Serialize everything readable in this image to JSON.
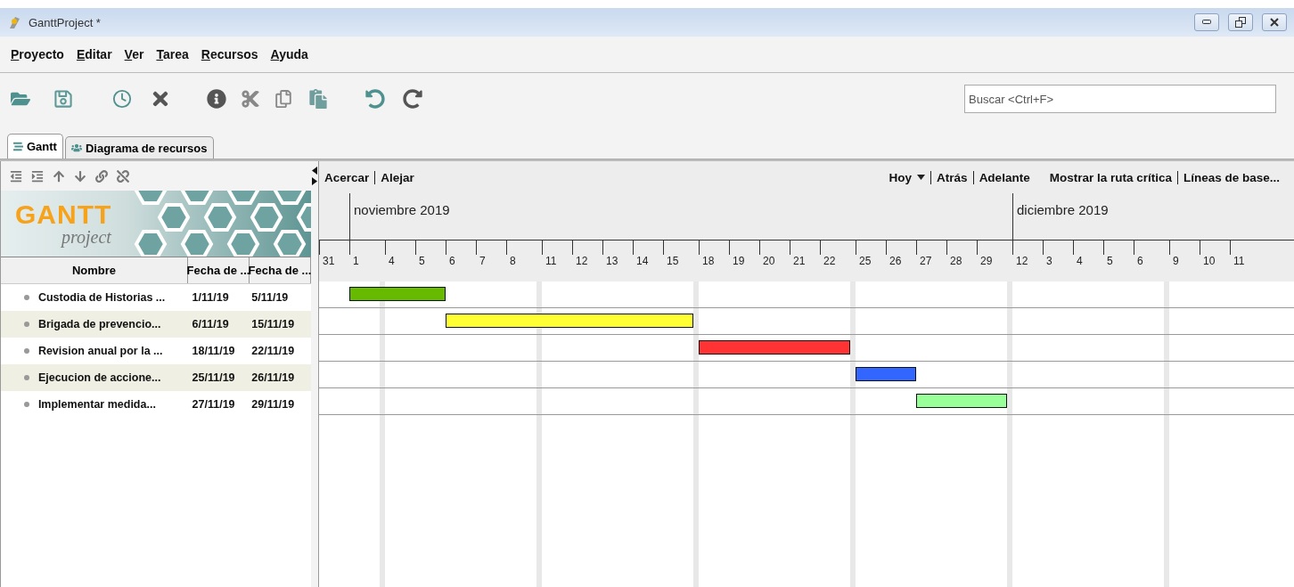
{
  "window": {
    "title": "GanttProject *"
  },
  "menu": [
    "Proyecto",
    "Editar",
    "Ver",
    "Tarea",
    "Recursos",
    "Ayuda"
  ],
  "search": {
    "placeholder": "Buscar <Ctrl+F>"
  },
  "tabs": [
    {
      "label": "Gantt",
      "selected": true
    },
    {
      "label": "Diagrama de recursos",
      "selected": false
    }
  ],
  "logo": {
    "title": "GANTT",
    "subtitle": "project"
  },
  "table": {
    "columns": [
      "Nombre",
      "Fecha de ...",
      "Fecha de ..."
    ],
    "rows": [
      {
        "name": "Custodia de Historias ...",
        "start": "1/11/19",
        "end": "5/11/19",
        "color": "#66bb00"
      },
      {
        "name": "Brigada de prevencio...",
        "start": "6/11/19",
        "end": "15/11/19",
        "color": "#ffff33"
      },
      {
        "name": "Revision anual por la ...",
        "start": "18/11/19",
        "end": "22/11/19",
        "color": "#ff3333"
      },
      {
        "name": "Ejecucion de accione...",
        "start": "25/11/19",
        "end": "26/11/19",
        "color": "#3366ff"
      },
      {
        "name": "Implementar medida...",
        "start": "27/11/19",
        "end": "29/11/19",
        "color": "#99ff99"
      }
    ]
  },
  "chart_toolbar": {
    "left": [
      {
        "label": "Acercar",
        "kind": "link"
      },
      {
        "label": "Alejar",
        "kind": "link"
      }
    ],
    "right": [
      [
        {
          "label": "Hoy",
          "kind": "dropdown"
        },
        {
          "label": "Atrás",
          "kind": "link"
        },
        {
          "label": "Adelante",
          "kind": "link"
        }
      ],
      [
        {
          "label": "Mostrar la ruta crítica",
          "kind": "link"
        },
        {
          "label": "Líneas de base...",
          "kind": "link"
        }
      ]
    ]
  },
  "timeline": {
    "pre_days": [
      {
        "kind": "day",
        "label": "31"
      }
    ],
    "months": [
      {
        "label": "noviembre 2019",
        "days": [
          {
            "kind": "day",
            "label": "1"
          },
          {
            "kind": "weekend"
          },
          {
            "kind": "day",
            "label": "4"
          },
          {
            "kind": "day",
            "label": "5"
          },
          {
            "kind": "day",
            "label": "6"
          },
          {
            "kind": "day",
            "label": "7"
          },
          {
            "kind": "day",
            "label": "8"
          },
          {
            "kind": "weekend"
          },
          {
            "kind": "day",
            "label": "11"
          },
          {
            "kind": "day",
            "label": "12"
          },
          {
            "kind": "day",
            "label": "13"
          },
          {
            "kind": "day",
            "label": "14"
          },
          {
            "kind": "day",
            "label": "15"
          },
          {
            "kind": "weekend"
          },
          {
            "kind": "day",
            "label": "18"
          },
          {
            "kind": "day",
            "label": "19"
          },
          {
            "kind": "day",
            "label": "20"
          },
          {
            "kind": "day",
            "label": "21"
          },
          {
            "kind": "day",
            "label": "22"
          },
          {
            "kind": "weekend"
          },
          {
            "kind": "day",
            "label": "25"
          },
          {
            "kind": "day",
            "label": "26"
          },
          {
            "kind": "day",
            "label": "27"
          },
          {
            "kind": "day",
            "label": "28"
          },
          {
            "kind": "day",
            "label": "29"
          },
          {
            "kind": "weekend"
          }
        ]
      },
      {
        "label": "diciembre 2019",
        "days": [
          {
            "kind": "day",
            "label": "12"
          },
          {
            "kind": "day",
            "label": "3"
          },
          {
            "kind": "day",
            "label": "4"
          },
          {
            "kind": "day",
            "label": "5"
          },
          {
            "kind": "day",
            "label": "6"
          },
          {
            "kind": "weekend"
          },
          {
            "kind": "day",
            "label": "9"
          },
          {
            "kind": "day",
            "label": "10"
          },
          {
            "kind": "day",
            "label": "11"
          }
        ]
      }
    ]
  }
}
